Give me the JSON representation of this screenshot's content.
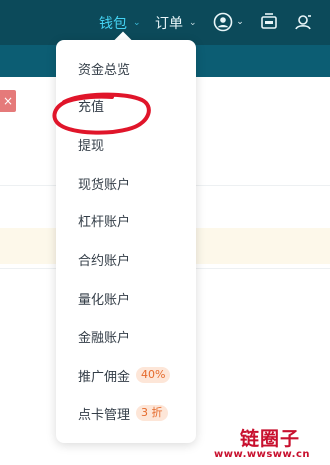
{
  "header": {
    "wallet_label": "钱包",
    "orders_label": "订单"
  },
  "icons": {
    "user": "user-circle-icon",
    "download": "download-app-icon",
    "support": "support-icon",
    "chevron": "chevron-down-icon"
  },
  "colors": {
    "topbar": "#0c4a5a",
    "active_nav": "#44d2f2",
    "annotation": "#e0152a",
    "badge_bg": "#fde6d8",
    "badge_text": "#e56a2c"
  },
  "close_button": "×",
  "wallet_menu": {
    "items": [
      {
        "label": "资金总览"
      },
      {
        "label": "充值"
      },
      {
        "label": "提现"
      },
      {
        "label": "现货账户"
      },
      {
        "label": "杠杆账户"
      },
      {
        "label": "合约账户"
      },
      {
        "label": "量化账户"
      },
      {
        "label": "金融账户"
      },
      {
        "label": "推广佣金",
        "badge": "40%"
      },
      {
        "label": "点卡管理",
        "badge": "3 折"
      }
    ]
  },
  "watermark": {
    "title": "链圈子",
    "url": "www.wwsww.cn"
  }
}
